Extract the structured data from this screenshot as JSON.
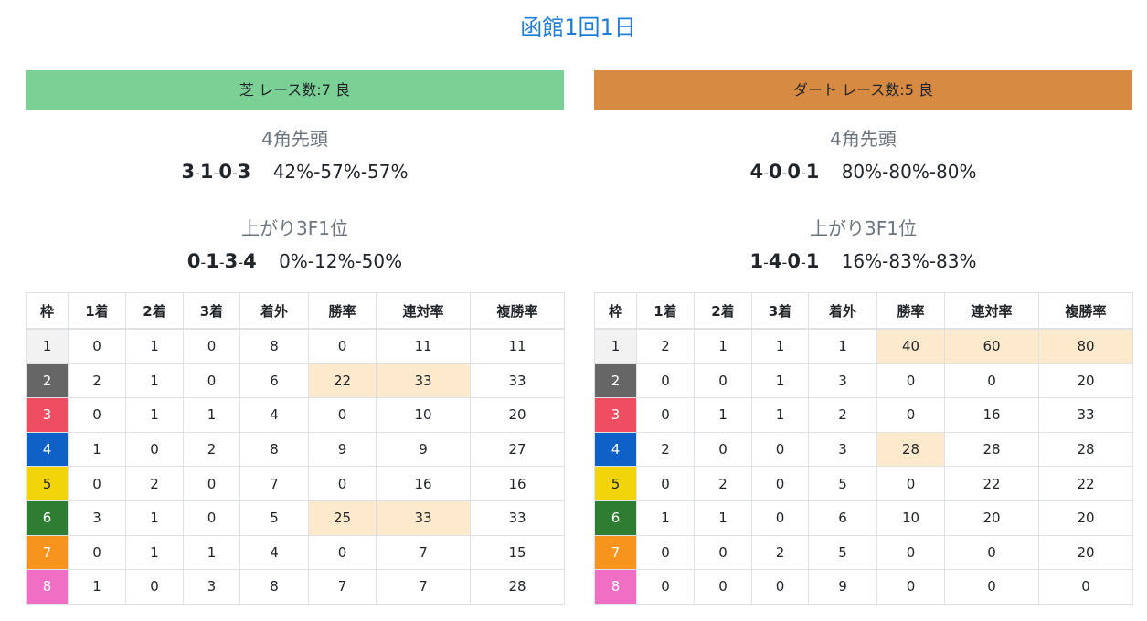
{
  "page_title": "函館1回1日",
  "colors": {
    "title": "#1e7ed6",
    "turf_header": "#7bd095",
    "dirt_header": "#d68a42",
    "highlight": "#fde9cc",
    "frames": [
      "#f2f2f2",
      "#666666",
      "#ef4e62",
      "#0f61c8",
      "#f1d40a",
      "#2e7d32",
      "#f7941d",
      "#f06fc4"
    ],
    "frame_text": [
      "#212529",
      "#ffffff",
      "#ffffff",
      "#ffffff",
      "#212529",
      "#ffffff",
      "#ffffff",
      "#ffffff"
    ]
  },
  "columns": [
    "枠",
    "1着",
    "2着",
    "3着",
    "着外",
    "勝率",
    "連対率",
    "複勝率"
  ],
  "turf": {
    "header": "芝 レース数:7 良",
    "corner4": {
      "heading": "4角先頭",
      "record": [
        "3",
        "1",
        "0",
        "3"
      ],
      "pct": "42%-57%-57%"
    },
    "last3f": {
      "heading": "上がり3F1位",
      "record": [
        "0",
        "1",
        "3",
        "4"
      ],
      "pct": "0%-12%-50%"
    },
    "rows": [
      {
        "cells": [
          "1",
          "0",
          "1",
          "0",
          "8",
          "0",
          "11",
          "11"
        ],
        "hl": []
      },
      {
        "cells": [
          "2",
          "2",
          "1",
          "0",
          "6",
          "22",
          "33",
          "33"
        ],
        "hl": [
          5,
          6
        ]
      },
      {
        "cells": [
          "3",
          "0",
          "1",
          "1",
          "4",
          "0",
          "10",
          "20"
        ],
        "hl": []
      },
      {
        "cells": [
          "4",
          "1",
          "0",
          "2",
          "8",
          "9",
          "9",
          "27"
        ],
        "hl": []
      },
      {
        "cells": [
          "5",
          "0",
          "2",
          "0",
          "7",
          "0",
          "16",
          "16"
        ],
        "hl": []
      },
      {
        "cells": [
          "6",
          "3",
          "1",
          "0",
          "5",
          "25",
          "33",
          "33"
        ],
        "hl": [
          5,
          6
        ]
      },
      {
        "cells": [
          "7",
          "0",
          "1",
          "1",
          "4",
          "0",
          "7",
          "15"
        ],
        "hl": []
      },
      {
        "cells": [
          "8",
          "1",
          "0",
          "3",
          "8",
          "7",
          "7",
          "28"
        ],
        "hl": []
      }
    ]
  },
  "dirt": {
    "header": "ダート レース数:5 良",
    "corner4": {
      "heading": "4角先頭",
      "record": [
        "4",
        "0",
        "0",
        "1"
      ],
      "pct": "80%-80%-80%"
    },
    "last3f": {
      "heading": "上がり3F1位",
      "record": [
        "1",
        "4",
        "0",
        "1"
      ],
      "pct": "16%-83%-83%"
    },
    "rows": [
      {
        "cells": [
          "1",
          "2",
          "1",
          "1",
          "1",
          "40",
          "60",
          "80"
        ],
        "hl": [
          5,
          6,
          7
        ]
      },
      {
        "cells": [
          "2",
          "0",
          "0",
          "1",
          "3",
          "0",
          "0",
          "20"
        ],
        "hl": []
      },
      {
        "cells": [
          "3",
          "0",
          "1",
          "1",
          "2",
          "0",
          "16",
          "33"
        ],
        "hl": []
      },
      {
        "cells": [
          "4",
          "2",
          "0",
          "0",
          "3",
          "28",
          "28",
          "28"
        ],
        "hl": [
          5
        ]
      },
      {
        "cells": [
          "5",
          "0",
          "2",
          "0",
          "5",
          "0",
          "22",
          "22"
        ],
        "hl": []
      },
      {
        "cells": [
          "6",
          "1",
          "1",
          "0",
          "6",
          "10",
          "20",
          "20"
        ],
        "hl": []
      },
      {
        "cells": [
          "7",
          "0",
          "0",
          "2",
          "5",
          "0",
          "0",
          "20"
        ],
        "hl": []
      },
      {
        "cells": [
          "8",
          "0",
          "0",
          "0",
          "9",
          "0",
          "0",
          "0"
        ],
        "hl": []
      }
    ]
  }
}
